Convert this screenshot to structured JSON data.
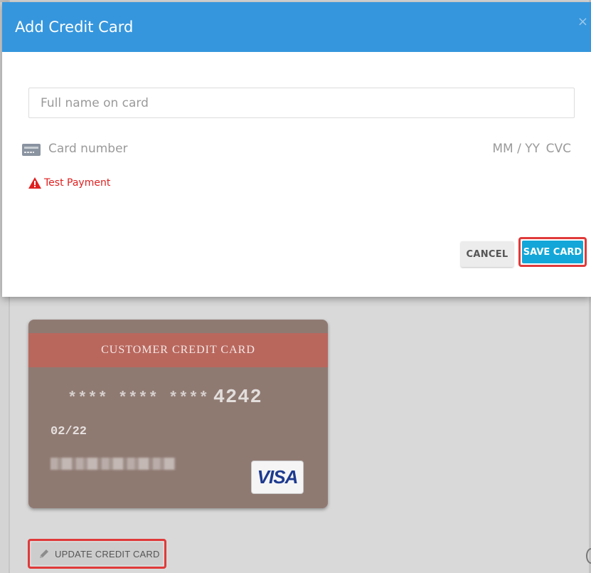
{
  "modal": {
    "title": "Add Credit Card",
    "close_symbol": "×",
    "name_placeholder": "Full name on card",
    "card_number_placeholder": "Card number",
    "expiry_placeholder": "MM / YY",
    "cvc_placeholder": "CVC",
    "test_payment_label": "Test Payment",
    "cancel_label": "CANCEL",
    "save_label": "SAVE CARD"
  },
  "card": {
    "header": "CUSTOMER CREDIT CARD",
    "masked_groups": "**** **** ****",
    "last4": "4242",
    "expiry": "02/22",
    "brand": "VISA"
  },
  "actions": {
    "update_label": "UPDATE CREDIT CARD"
  },
  "colors": {
    "header_blue": "#3596dd",
    "save_button": "#12a7d8",
    "card_body": "#8f7a72",
    "card_header": "#b9675d",
    "highlight_red": "#e03a3a",
    "warning_red": "#e02020"
  },
  "icons": {
    "card": "credit-card-icon",
    "warning": "warning-triangle-icon",
    "edit": "pencil-icon",
    "close": "close-icon"
  }
}
